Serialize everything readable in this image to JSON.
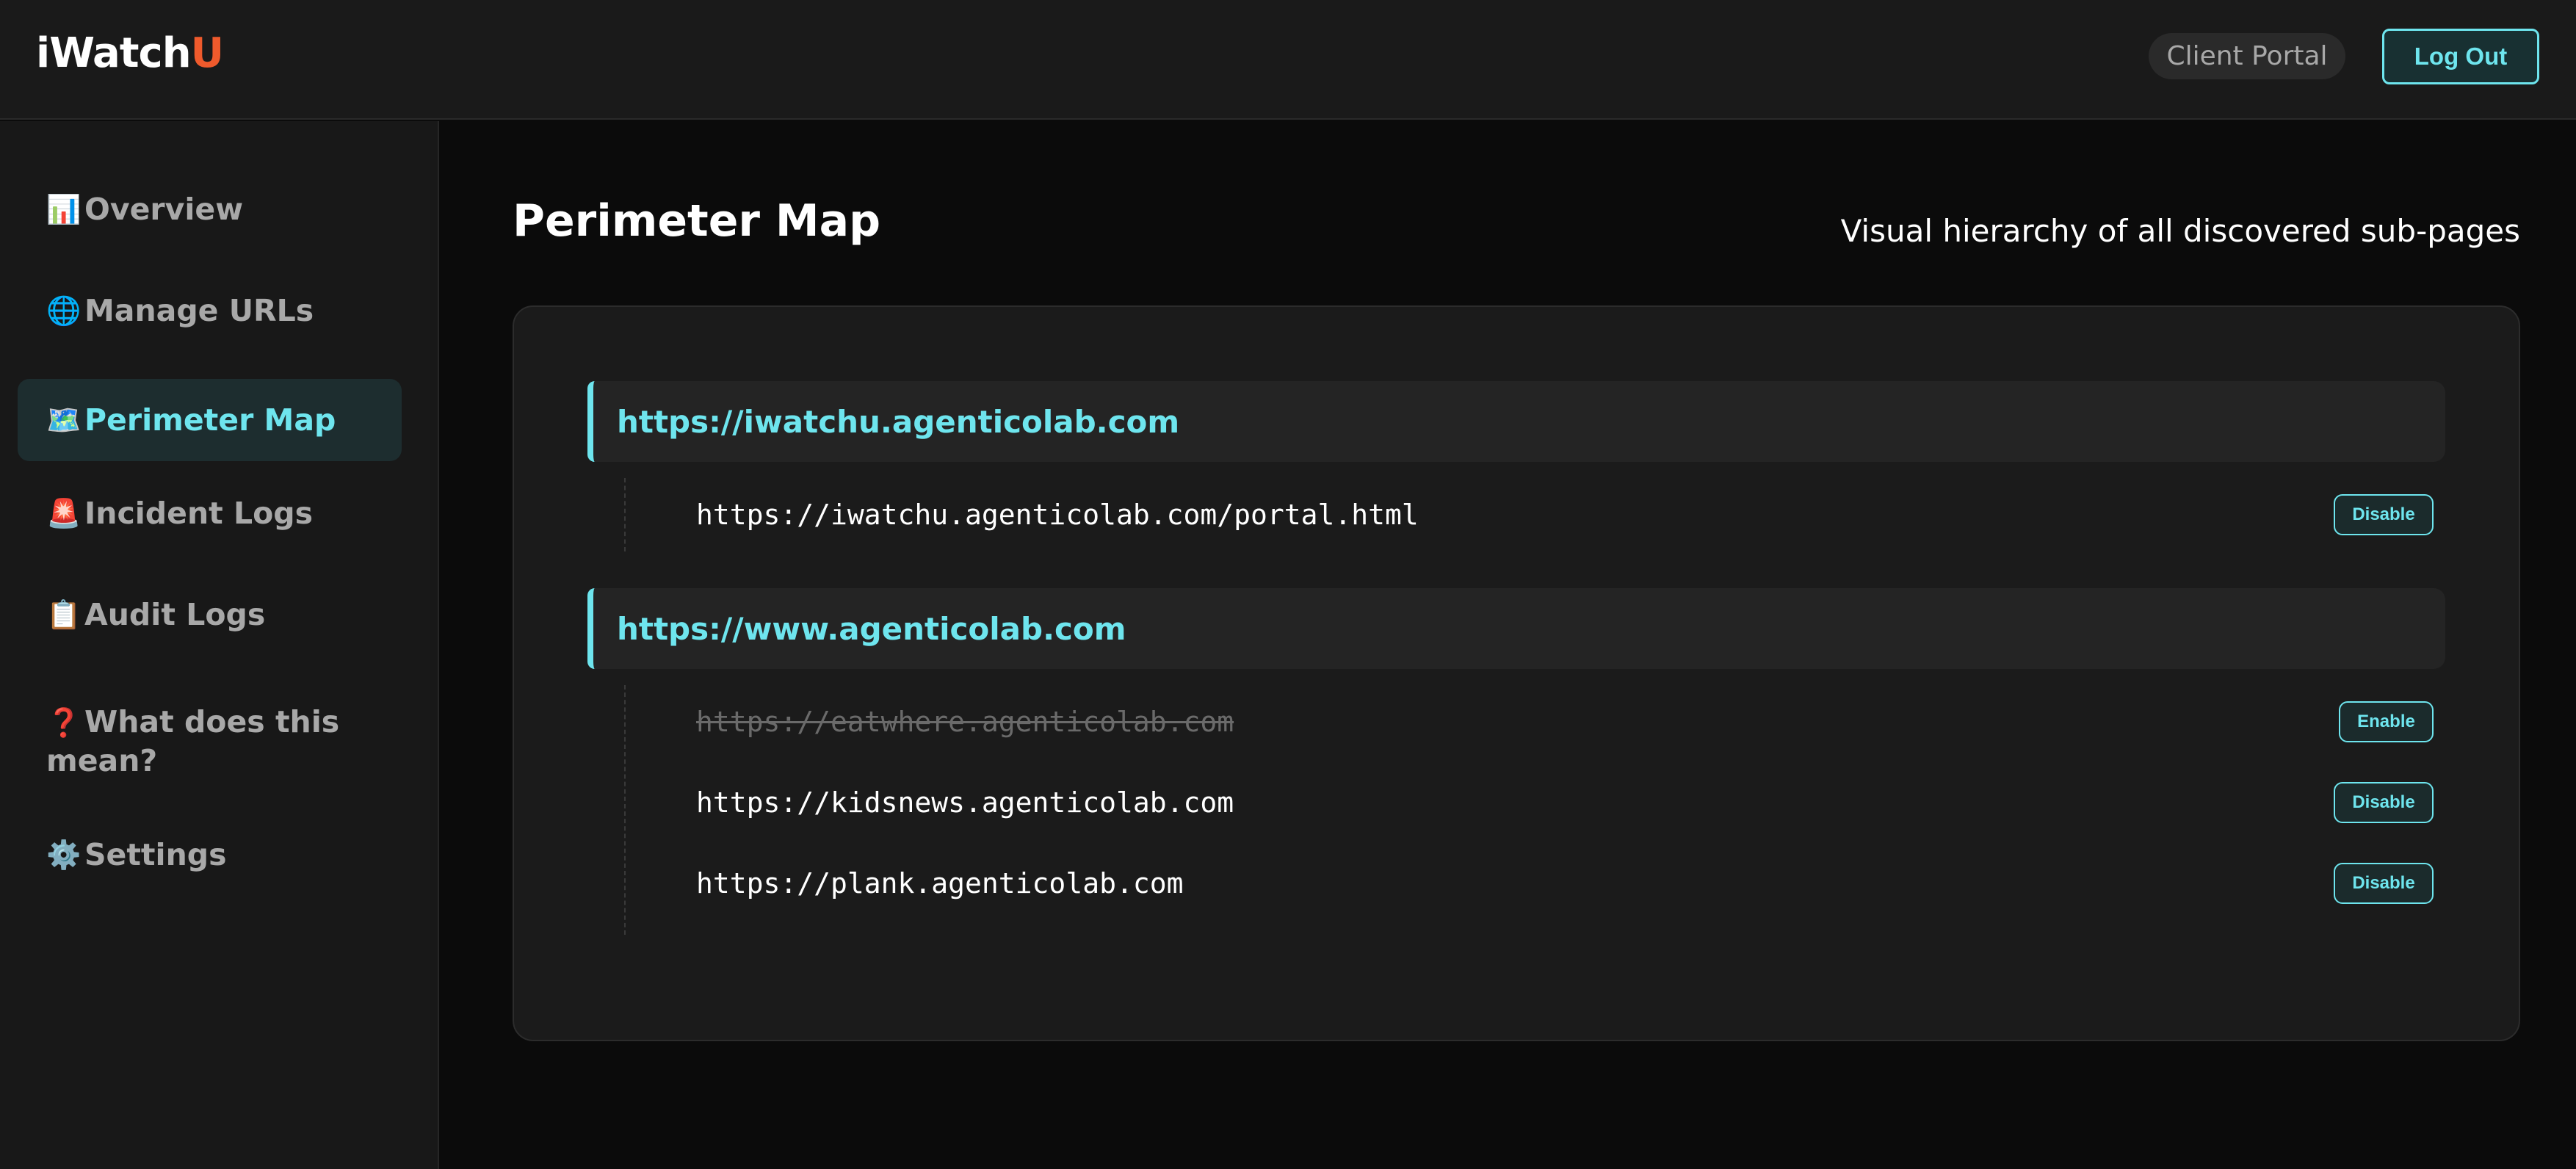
{
  "header": {
    "logo_main": "iWatch",
    "logo_accent": "U",
    "portal_label": "Client Portal",
    "logout_label": "Log Out"
  },
  "sidebar": {
    "items": [
      {
        "icon": "📊",
        "icon_name": "bar-chart-icon",
        "label": "Overview"
      },
      {
        "icon": "🌐",
        "icon_name": "globe-icon",
        "label": "Manage URLs"
      },
      {
        "icon": "🗺️",
        "icon_name": "map-icon",
        "label": "Perimeter Map",
        "active": true
      },
      {
        "icon": "🚨",
        "icon_name": "siren-icon",
        "label": "Incident Logs"
      },
      {
        "icon": "📋",
        "icon_name": "clipboard-icon",
        "label": "Audit Logs"
      },
      {
        "icon": "❓",
        "icon_name": "question-mark-icon",
        "label": "What does this mean?"
      },
      {
        "icon": "⚙️",
        "icon_name": "gear-icon",
        "label": "Settings"
      }
    ]
  },
  "main": {
    "title": "Perimeter Map",
    "subtitle": "Visual hierarchy of all discovered sub-pages",
    "domains": [
      {
        "url": "https://iwatchu.agenticolab.com",
        "children": [
          {
            "url": "https://iwatchu.agenticolab.com/portal.html",
            "enabled": true,
            "action": "Disable"
          }
        ]
      },
      {
        "url": "https://www.agenticolab.com",
        "children": [
          {
            "url": "https://eatwhere.agenticolab.com",
            "enabled": false,
            "action": "Enable"
          },
          {
            "url": "https://kidsnews.agenticolab.com",
            "enabled": true,
            "action": "Disable"
          },
          {
            "url": "https://plank.agenticolab.com",
            "enabled": true,
            "action": "Disable"
          }
        ]
      }
    ]
  },
  "colors": {
    "accent": "#6ee5ee",
    "logo_accent": "#ef5a2c",
    "background": "#0b0b0b",
    "panel": "#1b1b1b"
  }
}
